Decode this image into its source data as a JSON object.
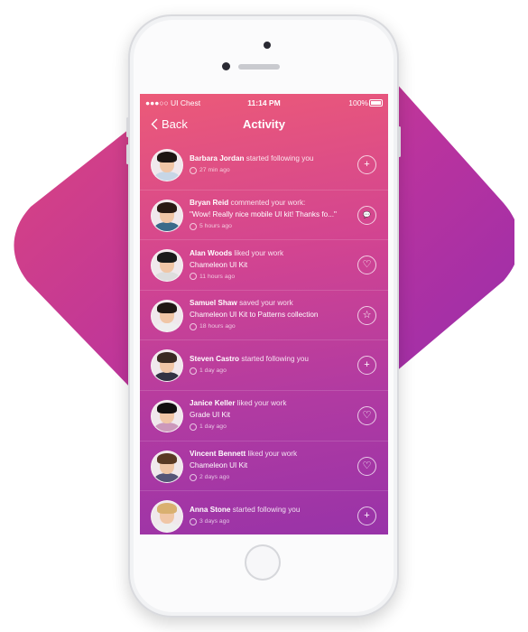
{
  "colors": {
    "accent_start": "#ec5a78",
    "accent_end": "#9833a8"
  },
  "status_bar": {
    "carrier": "●●●○○ UI Chest",
    "time": "11:14 PM",
    "battery": "100%"
  },
  "nav": {
    "back_label": "Back",
    "title": "Activity"
  },
  "items": [
    {
      "name": "Barbara Jordan",
      "action": "started following you",
      "detail": "",
      "time": "27 min ago",
      "icon": "plus-icon"
    },
    {
      "name": "Bryan Reid",
      "action": "commented your work:",
      "detail": "\"Wow! Really nice mobile UI kit! Thanks fo...\"",
      "time": "5 hours ago",
      "icon": "comment-icon"
    },
    {
      "name": "Alan Woods",
      "action": "liked your work",
      "detail": "Chameleon UI Kit",
      "time": "11 hours ago",
      "icon": "heart-icon"
    },
    {
      "name": "Samuel Shaw",
      "action": "saved your work",
      "detail": "Chameleon UI Kit to Patterns collection",
      "time": "18 hours ago",
      "icon": "star-icon"
    },
    {
      "name": "Steven Castro",
      "action": "started following you",
      "detail": "",
      "time": "1 day ago",
      "icon": "plus-icon"
    },
    {
      "name": "Janice Keller",
      "action": "liked your work",
      "detail": "Grade UI Kit",
      "time": "1 day ago",
      "icon": "heart-icon"
    },
    {
      "name": "Vincent Bennett",
      "action": "liked your work",
      "detail": "Chameleon UI Kit",
      "time": "2 days ago",
      "icon": "heart-icon"
    },
    {
      "name": "Anna Stone",
      "action": "started following you",
      "detail": "",
      "time": "3 days ago",
      "icon": "plus-icon"
    }
  ]
}
